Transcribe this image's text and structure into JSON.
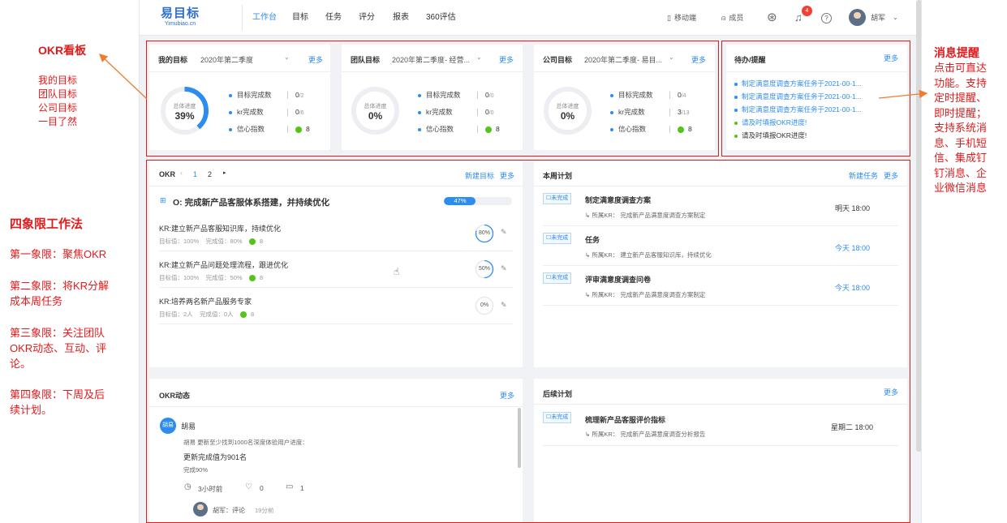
{
  "header": {
    "logo_cn": "易目标",
    "logo_en": "Yimubiao.cn",
    "nav": [
      "工作台",
      "目标",
      "任务",
      "评分",
      "报表",
      "360评估"
    ],
    "mobile": "移动端",
    "members": "成员",
    "notif_count": "4",
    "user": "胡军"
  },
  "my_goal": {
    "title": "我的目标",
    "period": "2020年第二季度",
    "more": "更多",
    "ring_label": "总体进度",
    "ring_value": "39%",
    "progress": 0.39,
    "stats": [
      "目标完成数",
      "kr完成数",
      "信心指数"
    ],
    "vals": [
      "0",
      "0",
      "8"
    ],
    "totals": [
      "/2",
      "/6",
      ""
    ]
  },
  "team_goal": {
    "title": "团队目标",
    "period": "2020年第二季度- 经营...",
    "more": "更多",
    "ring_label": "总体进度",
    "ring_value": "0%",
    "progress": 0,
    "stats": [
      "目标完成数",
      "kr完成数",
      "信心指数"
    ],
    "vals": [
      "0",
      "0",
      "8"
    ],
    "totals": [
      "/0",
      "/0",
      ""
    ]
  },
  "company_goal": {
    "title": "公司目标",
    "period": "2020年第二季度- 易目...",
    "more": "更多",
    "ring_label": "总体进度",
    "ring_value": "0%",
    "progress": 0,
    "stats": [
      "目标完成数",
      "kr完成数",
      "信心指数"
    ],
    "vals": [
      "0",
      "3",
      "8"
    ],
    "totals": [
      "/4",
      "/13",
      ""
    ]
  },
  "reminders": {
    "title": "待办/提醒",
    "more": "更多",
    "items": [
      "制定满意度调查方案任务于2021-00-1...",
      "制定满意度调查方案任务于2021-00-1...",
      "制定满意度调查方案任务于2021-00-1...",
      "请及时填报OKR进度!",
      "请及时填报OKR进度!"
    ]
  },
  "okr": {
    "title": "OKR",
    "pages": [
      "1",
      "2"
    ],
    "new_goal": "新建目标",
    "more": "更多",
    "objective": "O: 完成新产品客服体系搭建，并持续优化",
    "objective_progress": "47%",
    "objective_fill": 0.47,
    "krs": [
      {
        "title": "KR:建立新产品客服知识库，持续优化",
        "target": "目标值：100%",
        "current": "完成值：80%",
        "conf": "8",
        "pct": "80%",
        "fill": 0.8
      },
      {
        "title": "KR:建立新产品问题处理流程，跟进优化",
        "target": "目标值：100%",
        "current": "完成值：50%",
        "conf": "8",
        "pct": "50%",
        "fill": 0.5
      },
      {
        "title": "KR:培养两名新产品服务专家",
        "target": "目标值：2人",
        "current": "完成值：0人",
        "conf": "8",
        "pct": "0%",
        "fill": 0
      }
    ]
  },
  "week_plan": {
    "title": "本周计划",
    "new_task": "新建任务",
    "more": "更多",
    "items": [
      {
        "tag": "☐未完成",
        "title": "制定满意度调查方案",
        "sub": "所属KR：  完成新产品满意度调查方案制定",
        "time": "明天 18:00"
      },
      {
        "tag": "☐未完成",
        "title": "任务",
        "sub": "所属KR：  建立新产品客服知识库，持续优化",
        "time": "今天 18:00"
      },
      {
        "tag": "☐未完成",
        "title": "评审满意度调查问卷",
        "sub": "所属KR：  完成新产品满意度调查方案制定",
        "time": "今天 18:00"
      }
    ]
  },
  "okr_feed": {
    "title": "OKR动态",
    "more": "更多",
    "avatar_text": "胡易",
    "user": "胡易",
    "line1": "胡易 更新至少找到1000名深度体验用户进度：",
    "line2": "更新完成值为901名",
    "line3": "完成90%",
    "time": "3小时前",
    "likes": "0",
    "comments": "1",
    "comment_user": "胡军：评论",
    "comment_time": "19分前"
  },
  "later_plan": {
    "title": "后续计划",
    "more": "更多",
    "tag": "☐未完成",
    "item_title": "梳理新产品客服评价指标",
    "item_sub": "所属KR：  完成新产品满意度调查分析报告",
    "item_time": "星期二 18:00"
  },
  "annotations": {
    "board_title": "OKR看板",
    "board_lines": [
      "我的目标",
      "团队目标",
      "公司目标",
      "一目了然"
    ],
    "quad_title": "四象限工作法",
    "q1": "第一象限：聚焦OKR",
    "q2a": "第二象限：将KR分解",
    "q2b": "成本周任务",
    "q3a": "第三象限：关注团队",
    "q3b": "OKR动态、互动、评",
    "q3c": "论。",
    "q4a": "第四象限：下周及后",
    "q4b": "续计划。",
    "msg_title": "消息提醒",
    "msg_lines": [
      "点击可直达",
      "功能。支持",
      "定时提醒、",
      "即时提醒；",
      "支持系统消",
      "息、手机短",
      "信、集成钉",
      "钉消息、企",
      "业微信消息"
    ]
  },
  "colors": {
    "accent": "#2d8cf0",
    "annotation": "#e31a1c",
    "confidence": "#52c41a"
  }
}
